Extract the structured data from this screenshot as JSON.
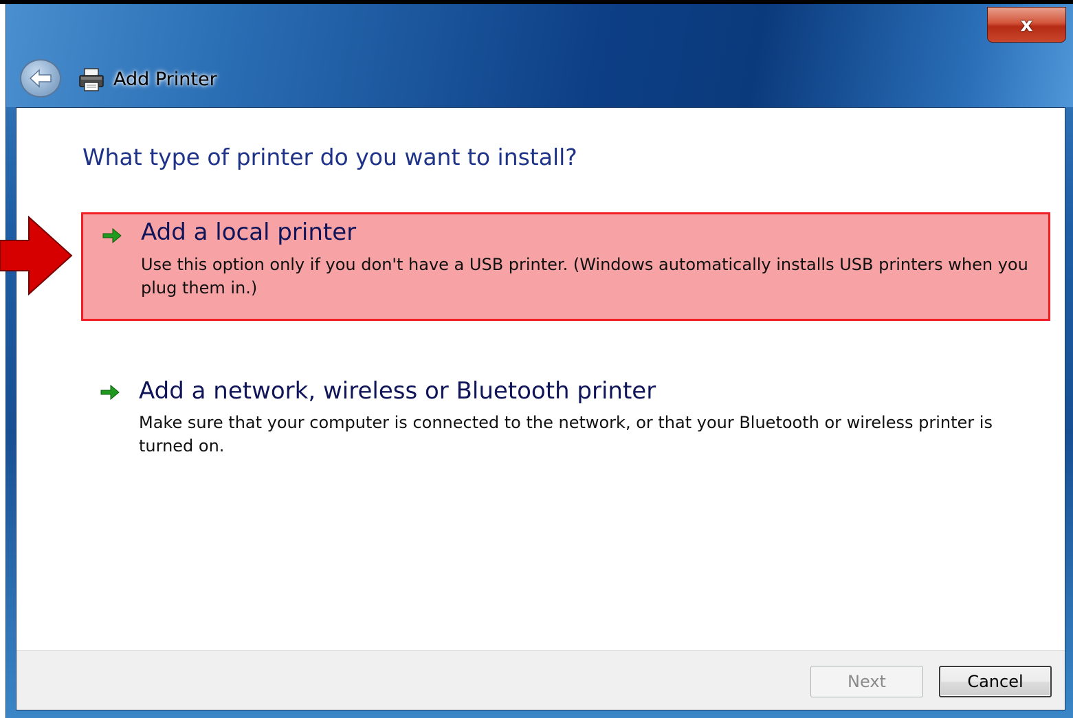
{
  "window": {
    "title": "Add Printer",
    "close_glyph": "x"
  },
  "wizard": {
    "heading": "What type of printer do you want to install?",
    "options": [
      {
        "title": "Add a local printer",
        "description": "Use this option only if you don't have a USB printer. (Windows automatically installs USB printers when you plug them in.)",
        "highlighted": true,
        "icon": "green-arrow-icon"
      },
      {
        "title": "Add a network, wireless or Bluetooth printer",
        "description": "Make sure that your computer is connected to the network, or that your Bluetooth or wireless printer is turned on.",
        "highlighted": false,
        "icon": "green-arrow-icon"
      }
    ]
  },
  "footer": {
    "next_label": "Next",
    "cancel_label": "Cancel",
    "next_enabled": false
  },
  "annotation": {
    "icon": "red-pointer-arrow-icon",
    "color": "#d60000"
  },
  "colors": {
    "heading": "#1e3287",
    "highlight_fill": "#f7a2a4",
    "highlight_border": "#ef1f24",
    "arrow_green": "#1f9a1f"
  }
}
